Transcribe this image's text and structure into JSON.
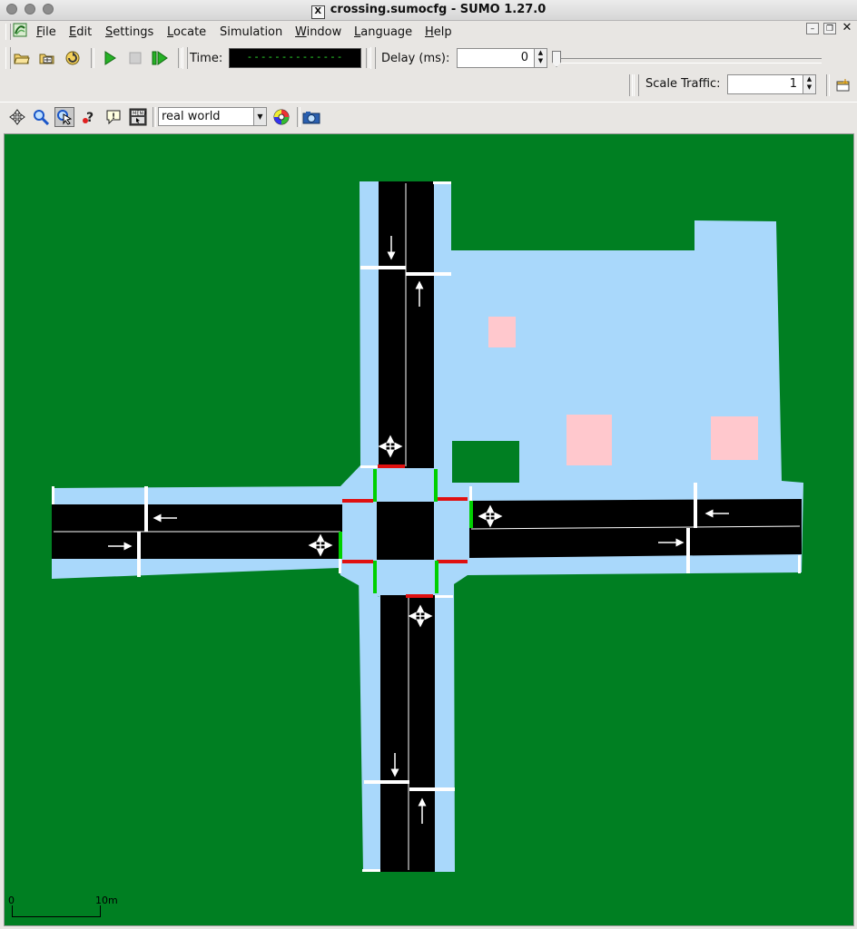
{
  "window": {
    "title": "crossing.sumocfg - SUMO 1.27.0",
    "x_glyph": "X"
  },
  "menu": [
    "File",
    "Edit",
    "Settings",
    "Locate",
    "Simulation",
    "Window",
    "Language",
    "Help"
  ],
  "toolbar": {
    "time_label": "Time:",
    "time_display": "--------------",
    "delay_label": "Delay (ms):",
    "delay_value": "0",
    "scale_label": "Scale Traffic:",
    "scale_value": "1"
  },
  "view": {
    "scheme": "real world",
    "scheme_icons": [
      "recenter-icon",
      "zoom-icon",
      "select-icon",
      "inspect-icon",
      "tooltip-icon",
      "menu-icon"
    ]
  },
  "scale_bar": {
    "start": "0",
    "end": "10m"
  },
  "colors": {
    "grass": "#007f22",
    "sidewalk": "#a9d8fb",
    "road": "#000000",
    "building": "#ffc8cd",
    "signal_green": "#00d000",
    "signal_red": "#e01010"
  }
}
